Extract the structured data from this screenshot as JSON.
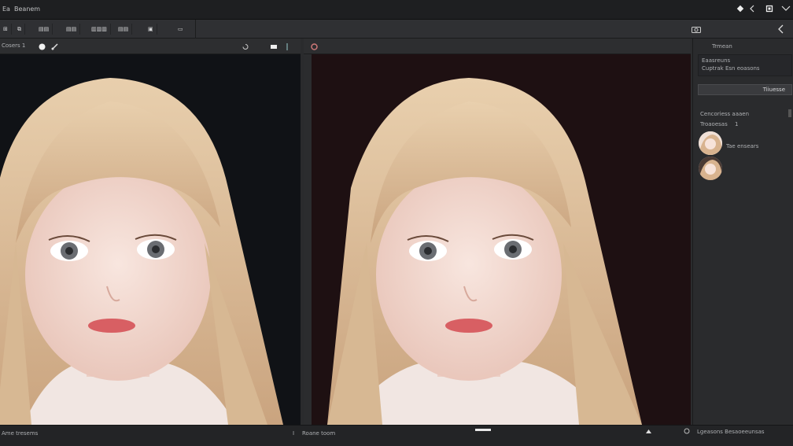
{
  "menubar": {
    "app_label": "Ea",
    "menu_label": "Beanem",
    "right_icons": [
      "diamond-icon",
      "chevron-left-icon",
      "square-icon",
      "share-icon"
    ]
  },
  "toolbar": {
    "buttons": [
      {
        "label": "⊞"
      },
      {
        "label": "⧉"
      },
      {
        "label": "▤▤"
      },
      {
        "label": "▤▤"
      },
      {
        "label": "▥▥▥"
      },
      {
        "label": "▤▤"
      },
      {
        "label": "▣"
      }
    ],
    "right_icon": "camera-icon",
    "collapse_icon": "chevron-left-icon"
  },
  "left_pane": {
    "title": "Cosers 1",
    "dot_icon": "circle-icon",
    "tool_icon": "brush-icon",
    "right_tools": [
      "rotate-icon",
      "rectangle-icon",
      "arrow-icon"
    ],
    "status": "Ame tresems"
  },
  "right_pane": {
    "title_icon": "record-icon",
    "status": "Roane toom"
  },
  "side_panel": {
    "header": "Trmean",
    "subheader_1": "Eaasreuns",
    "subheader_2": "Cuptrak  Esn  eoasons",
    "button": "Tiiuesse",
    "section_label": "Cencoriess  aaaen",
    "item_label": "Troaoesas",
    "item_value": "1",
    "thumb_1_label": "Tae  ensears",
    "footer": "Lgeasons  Besaoeeunsas"
  },
  "colors": {
    "background": "#2b2c2e",
    "left_canvas": "#101216",
    "right_canvas": "#1e1012",
    "hair": "#e2c9a8",
    "skin": "#f3ddd5"
  }
}
